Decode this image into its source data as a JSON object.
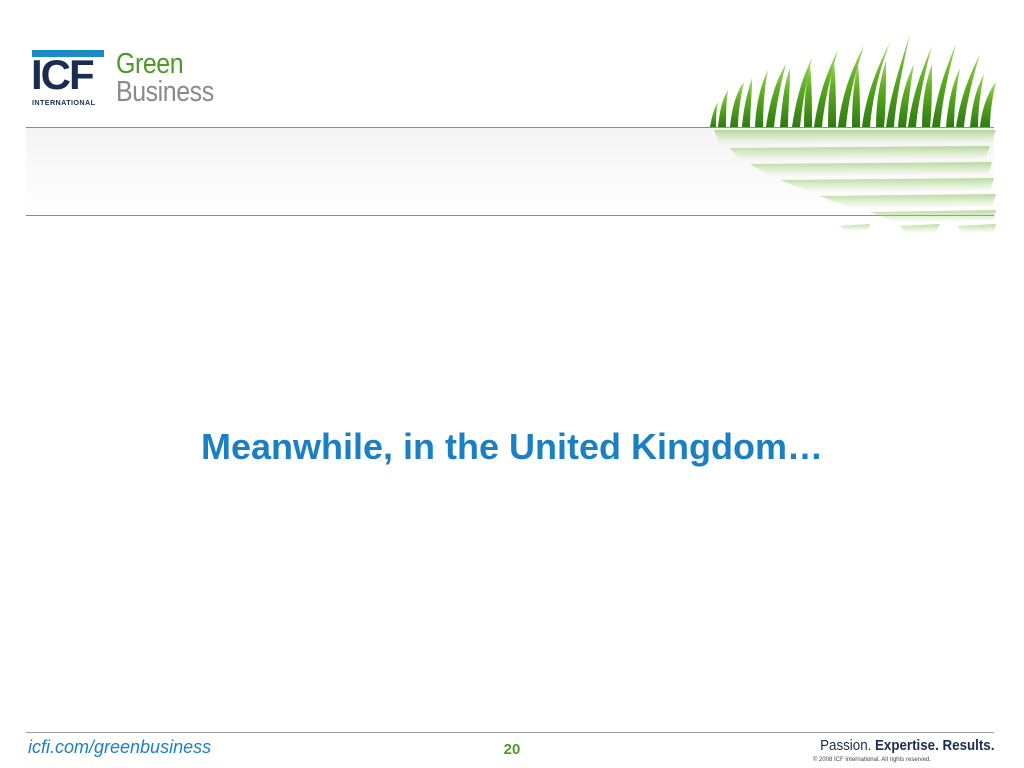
{
  "logo": {
    "mark": "ICF",
    "sub": "INTERNATIONAL",
    "word_line1": "Green",
    "word_line2": "Business",
    "colors": {
      "bar": "#1b8cc8",
      "mark": "#1a2d4f",
      "green": "#4d9a2a",
      "gray": "#8a8a8a"
    }
  },
  "header": {
    "decoration": "grass-image"
  },
  "slide": {
    "title": "Meanwhile, in the United Kingdom…",
    "title_color": "#1b7fc4"
  },
  "footer": {
    "url": "icfi.com/greenbusiness",
    "page_number": "20",
    "tagline": {
      "passion": "Passion.",
      "expertise": "Expertise.",
      "results": "Results."
    },
    "copyright": "© 2008 ICF International. All rights reserved."
  }
}
